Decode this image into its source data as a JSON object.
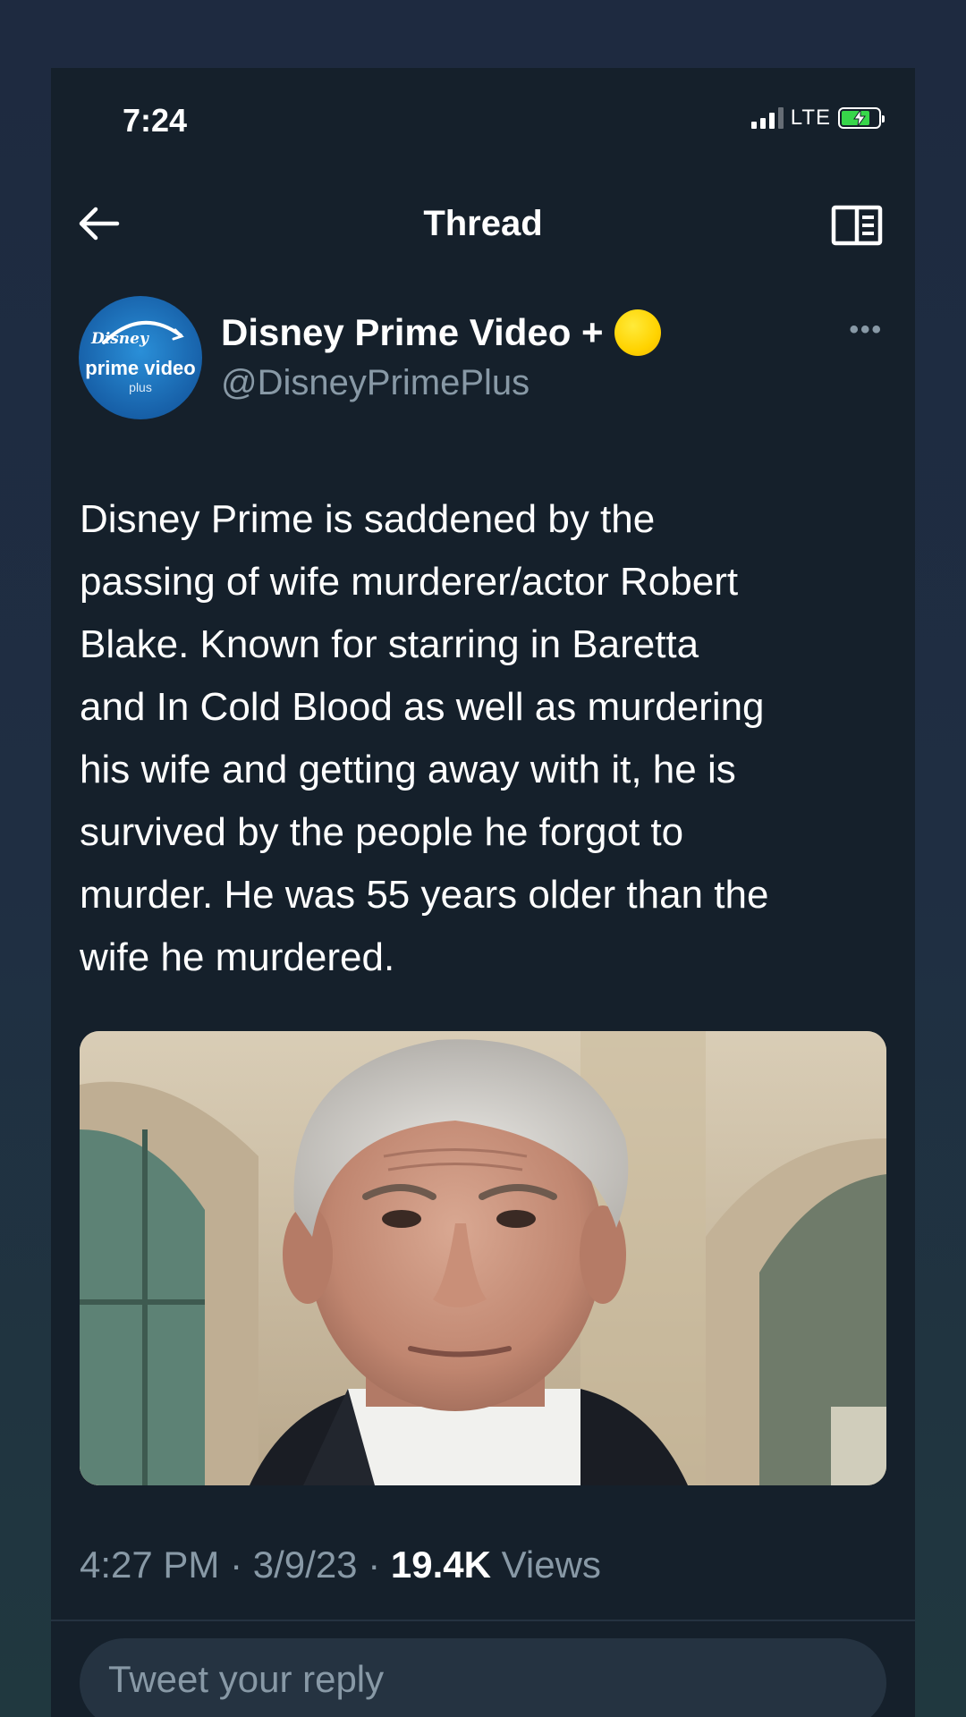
{
  "status_bar": {
    "time": "7:24",
    "network": "LTE",
    "battery_charging": true,
    "battery_color": "#37d64a"
  },
  "header": {
    "title": "Thread",
    "back_icon": "arrow-left-icon",
    "reader_icon": "reader-mode-icon"
  },
  "tweet": {
    "author": {
      "display_name": "Disney Prime Video +",
      "emoji": "yellow-circle",
      "handle": "@DisneyPrimePlus",
      "avatar_text": {
        "top": "Disney",
        "main": "prime video",
        "sub": "plus"
      }
    },
    "text": "Disney Prime is saddened by the\npassing of wife murderer/actor Robert\nBlake. Known for starring in Baretta\nand In Cold Blood as well as murdering\nhis wife and getting away with it, he is\nsurvived by the people he forgot to\nmurder. He was 55 years older than the\nwife he murdered.",
    "media": {
      "type": "photo",
      "icon": "photo-of-elderly-man"
    },
    "time": "4:27 PM",
    "separator": "·",
    "date": "3/9/23",
    "views_count": "19.4K",
    "views_label": "Views"
  },
  "reply": {
    "placeholder": "Tweet your reply"
  },
  "colors": {
    "background": "#15202b",
    "secondary_text": "#8899a6",
    "primary_text": "#ffffff"
  }
}
